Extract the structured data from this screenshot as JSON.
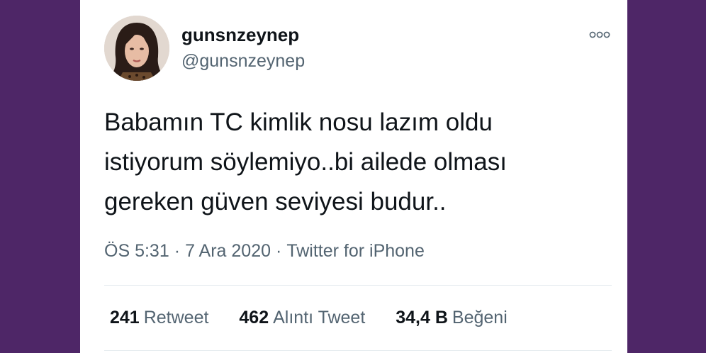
{
  "user": {
    "display_name": "gunsnzeynep",
    "handle": "@gunsnzeynep"
  },
  "tweet": {
    "lines": [
      "Babamın TC kimlik nosu lazım oldu",
      "istiyorum söylemiyo..bi ailede olması",
      "gereken güven seviyesi budur.."
    ]
  },
  "meta": {
    "time": "ÖS 5:31",
    "date": "7 Ara 2020",
    "source": "Twitter for iPhone",
    "separator": "·"
  },
  "stats": {
    "retweets": {
      "count": "241",
      "label": "Retweet"
    },
    "quotes": {
      "count": "462",
      "label": "Alıntı Tweet"
    },
    "likes": {
      "count": "34,4 B",
      "label": "Beğeni"
    }
  },
  "icons": {
    "more": "more-options-icon",
    "avatar": "profile-photo"
  },
  "colors": {
    "background": "#4e2667",
    "card": "#ffffff",
    "text_primary": "#0f1419",
    "text_secondary": "#536471"
  }
}
